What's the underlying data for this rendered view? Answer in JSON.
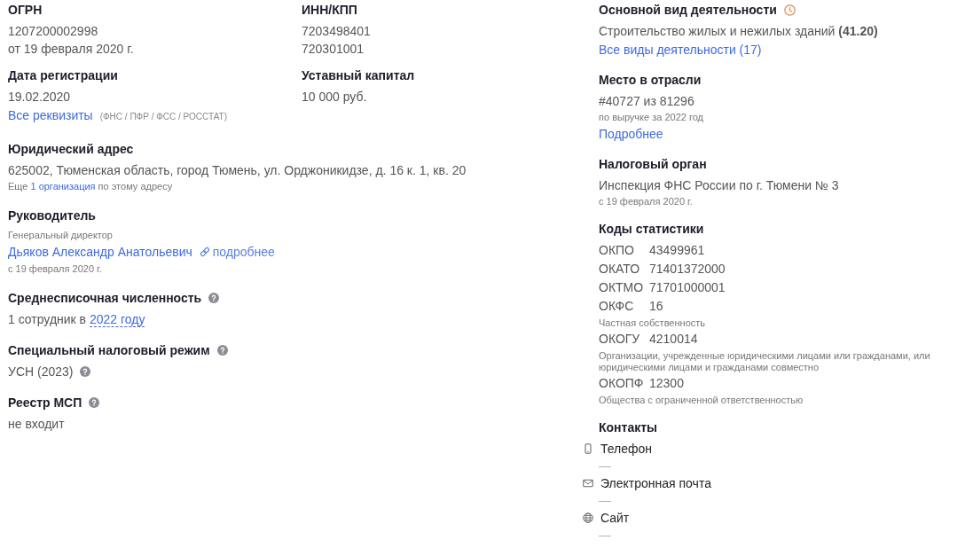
{
  "left_column": [
    {
      "kind": "pair",
      "cells": [
        {
          "title": "ОГРН",
          "lines": [
            {
              "kind": "value",
              "text": "1207200002998",
              "help": false
            },
            {
              "kind": "value",
              "text": "от 19 февраля 2020 г.",
              "help": false
            }
          ]
        },
        {
          "title": "ИНН/КПП",
          "lines": [
            {
              "kind": "value",
              "text": "7203498401",
              "help": false
            },
            {
              "kind": "value",
              "text": "720301001",
              "help": false
            }
          ]
        }
      ]
    },
    {
      "kind": "pair",
      "cells": [
        {
          "title": "Дата регистрации",
          "lines": [
            {
              "kind": "value",
              "text": "19.02.2020",
              "help": false
            },
            {
              "kind": "link",
              "text": "Все реквизиты",
              "note": "(ФНС / ПФР / ФСС / РОССТАТ)"
            }
          ]
        },
        {
          "title": "Уставный капитал",
          "lines": [
            {
              "kind": "value",
              "text": "10 000 руб.",
              "help": false
            }
          ]
        }
      ]
    },
    {
      "kind": "single",
      "title": "Юридический адрес",
      "help": false,
      "history": false,
      "lines": [
        {
          "kind": "value",
          "text": "625002, Тюменская область, город Тюмень, ул. Орджоникидзе, д. 16 к. 1, кв. 20",
          "help": false
        },
        {
          "kind": "note",
          "parts": [
            {
              "kind": "text",
              "text": "Еще"
            },
            {
              "kind": "link",
              "text": "1 организация"
            },
            {
              "kind": "text",
              "text": "по этому адресу"
            }
          ]
        }
      ]
    },
    {
      "kind": "single",
      "title": "Руководитель",
      "help": false,
      "history": false,
      "lines": [
        {
          "kind": "note",
          "text": "Генеральный директор"
        },
        {
          "kind": "person",
          "name": "Дьяков Александр Анатольевич",
          "more": "подробнее"
        },
        {
          "kind": "note",
          "text": "с 19 февраля 2020 г."
        }
      ]
    },
    {
      "kind": "single",
      "title": "Среднесписочная численность",
      "help": true,
      "history": false,
      "lines": [
        {
          "kind": "value",
          "help": false,
          "parts": [
            {
              "kind": "text",
              "text": "1 сотрудник в"
            },
            {
              "kind": "term",
              "text": "2022 году"
            }
          ]
        }
      ]
    },
    {
      "kind": "single",
      "title": "Специальный налоговый режим",
      "help": true,
      "history": false,
      "lines": [
        {
          "kind": "value",
          "text": "УСН (2023)",
          "help": true
        }
      ]
    },
    {
      "kind": "single",
      "title": "Реестр МСП",
      "help": true,
      "history": false,
      "lines": [
        {
          "kind": "value",
          "text": "не входит",
          "help": false
        }
      ]
    }
  ],
  "right_column": [
    {
      "kind": "single",
      "title": "Основной вид деятельности",
      "help": false,
      "history": true,
      "lines": [
        {
          "kind": "value",
          "text": "Строительство жилых и нежилых зданий **(41.20)**",
          "help": false
        },
        {
          "kind": "link",
          "text": "Все виды деятельности (17)"
        }
      ]
    },
    {
      "kind": "single",
      "title": "Место в отрасли",
      "help": false,
      "history": false,
      "lines": [
        {
          "kind": "value",
          "text": "#40727 из 81296",
          "help": false
        },
        {
          "kind": "note",
          "text": "по выручке за 2022 год"
        },
        {
          "kind": "link",
          "text": "Подробнее"
        }
      ]
    },
    {
      "kind": "single",
      "title": "Налоговый орган",
      "help": false,
      "history": false,
      "lines": [
        {
          "kind": "value",
          "text": "Инспекция ФНС России по г. Тюмени № 3",
          "help": false
        },
        {
          "kind": "note",
          "text": "с 19 февраля 2020 г."
        }
      ]
    },
    {
      "kind": "single",
      "title": "Коды статистики",
      "help": false,
      "history": false,
      "lines": [
        {
          "kind": "code",
          "code": "ОКПО",
          "value": "43499961"
        },
        {
          "kind": "code",
          "code": "ОКАТО",
          "value": "71401372000"
        },
        {
          "kind": "code",
          "code": "ОКТМО",
          "value": "71701000001"
        },
        {
          "kind": "code",
          "code": "ОКФС",
          "value": "16"
        },
        {
          "kind": "note",
          "text": "Частная собственность"
        },
        {
          "kind": "code",
          "code": "ОКОГУ",
          "value": "4210014"
        },
        {
          "kind": "note",
          "text": "Организации, учрежденные юридическими лицами или гражданами, или юридическими лицами и гражданами совместно"
        },
        {
          "kind": "code",
          "code": "ОКОПФ",
          "value": "12300"
        },
        {
          "kind": "note",
          "text": "Общества с ограниченной ответственностью"
        }
      ]
    },
    {
      "kind": "single",
      "title": "Контакты",
      "help": false,
      "history": false,
      "lines": [
        {
          "kind": "contact",
          "label": "Телефон",
          "value": "—"
        },
        {
          "kind": "contact",
          "label": "Электронная почта",
          "value": "—"
        },
        {
          "kind": "contact",
          "label": "Сайт",
          "value": "—"
        }
      ]
    }
  ]
}
